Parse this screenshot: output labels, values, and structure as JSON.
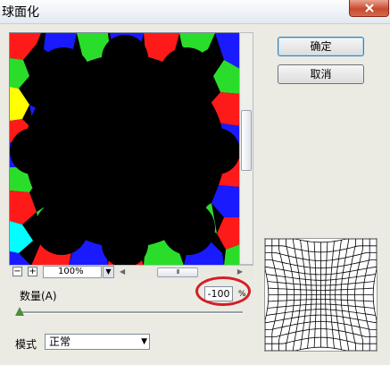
{
  "window": {
    "title": "球面化",
    "close_icon": "close-icon"
  },
  "preview": {
    "colors": {
      "red": "#ff1a1a",
      "green": "#2bdd2b",
      "blue": "#1a1aff",
      "black": "#000000"
    }
  },
  "zoom": {
    "minus_label": "−",
    "plus_label": "+",
    "value": "100%"
  },
  "buttons": {
    "ok_label": "确定",
    "cancel_label": "取消"
  },
  "amount": {
    "label": "数量(A)",
    "value": "-100",
    "unit": "%",
    "slider_level": 0
  },
  "mode": {
    "label": "模式",
    "value": "正常"
  }
}
